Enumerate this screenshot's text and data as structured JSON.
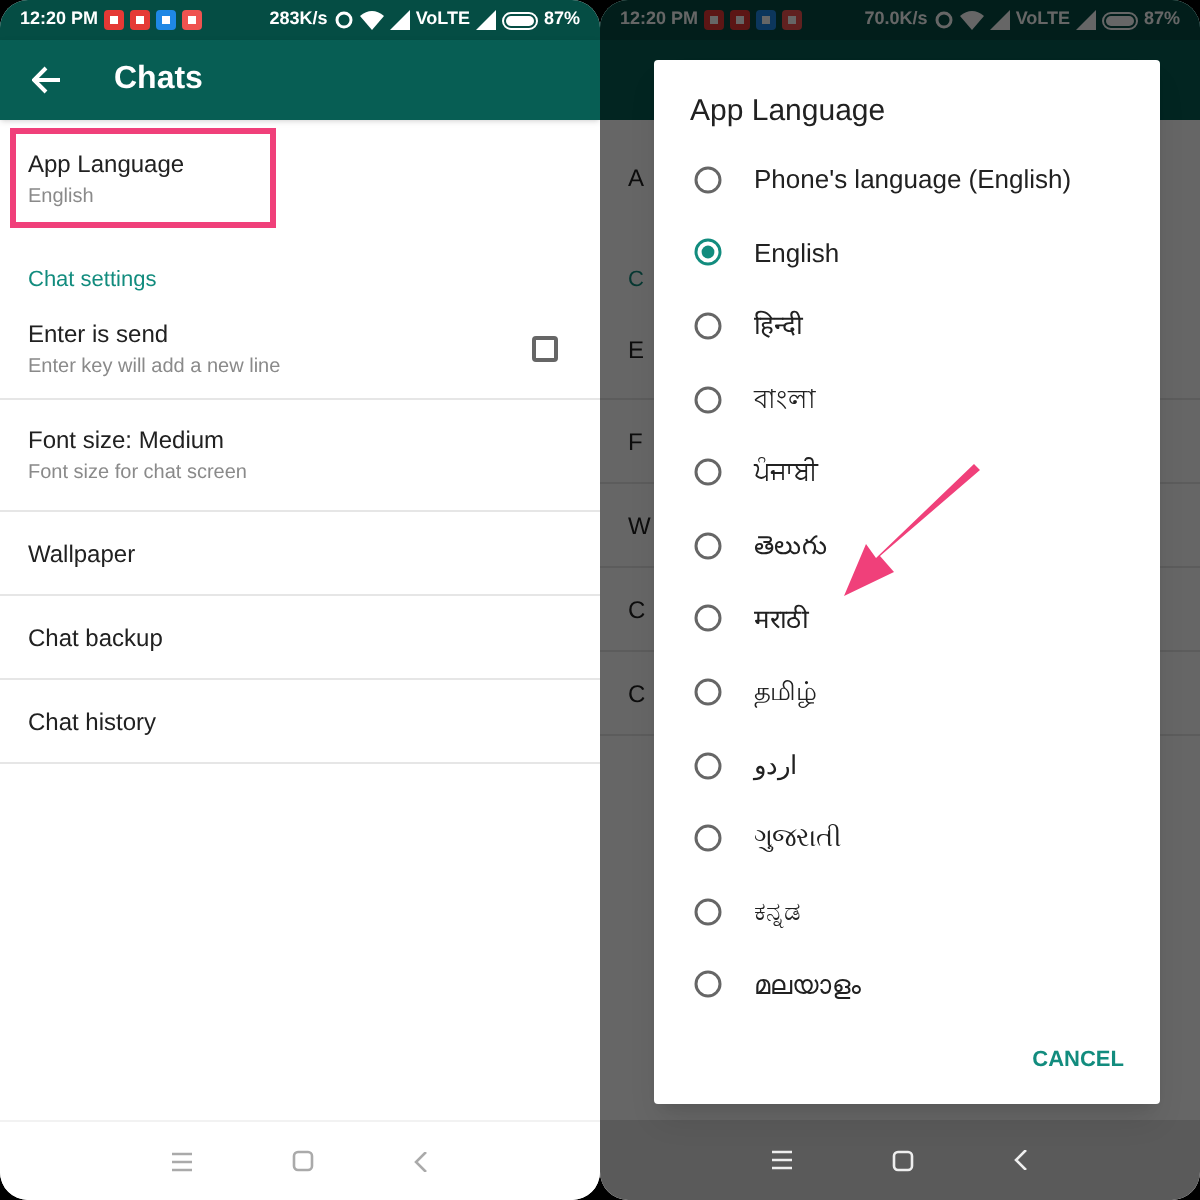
{
  "left_screen": {
    "status_bar": {
      "time": "12:20 PM",
      "speed": "283K/s",
      "network": "VoLTE",
      "battery": "87%"
    },
    "toolbar": {
      "title": "Chats"
    },
    "settings": [
      {
        "kind": "item",
        "title": "App Language",
        "subtitle": "English",
        "highlighted": true
      },
      {
        "kind": "header",
        "title": "Chat settings"
      },
      {
        "kind": "checkbox",
        "title": "Enter is send",
        "subtitle": "Enter key will add a new line",
        "checked": false
      },
      {
        "kind": "item",
        "title": "Font size: Medium",
        "subtitle": "Font size for chat screen",
        "highlighted": false
      },
      {
        "kind": "item",
        "title": "Wallpaper",
        "highlighted": false
      },
      {
        "kind": "item",
        "title": "Chat backup",
        "highlighted": false
      },
      {
        "kind": "item",
        "title": "Chat history",
        "highlighted": false
      }
    ]
  },
  "right_screen": {
    "status_bar": {
      "time": "12:20 PM",
      "speed": "70.0K/s",
      "network": "VoLTE",
      "battery": "87%"
    },
    "background_settings": [
      {
        "kind": "item",
        "title": "A"
      },
      {
        "kind": "header",
        "title": "C"
      },
      {
        "kind": "checkbox",
        "title": "E"
      },
      {
        "kind": "item",
        "title": "F"
      },
      {
        "kind": "item",
        "title": "W"
      },
      {
        "kind": "item",
        "title": "C"
      },
      {
        "kind": "item",
        "title": "C"
      }
    ],
    "dialog": {
      "title": "App Language",
      "options": [
        {
          "label": "Phone's language (English)",
          "selected": false
        },
        {
          "label": "English",
          "selected": true
        },
        {
          "label": "हिन्दी",
          "selected": false
        },
        {
          "label": "বাংলা",
          "selected": false
        },
        {
          "label": "ਪੰਜਾਬੀ",
          "selected": false
        },
        {
          "label": "తెలుగు",
          "selected": false
        },
        {
          "label": "मराठी",
          "selected": false
        },
        {
          "label": "தமிழ்",
          "selected": false
        },
        {
          "label": "اردو",
          "selected": false
        },
        {
          "label": "ગુજરાતી",
          "selected": false
        },
        {
          "label": "ಕನ್ನಡ",
          "selected": false
        },
        {
          "label": "മലയാളം",
          "selected": false
        }
      ],
      "button": "CANCEL"
    }
  }
}
